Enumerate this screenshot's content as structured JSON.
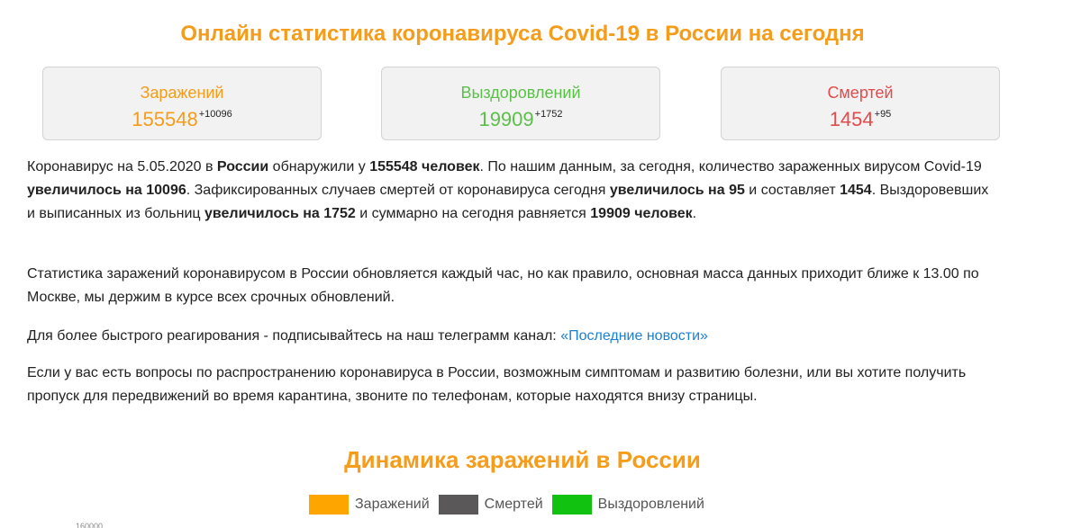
{
  "header": {
    "title": "Онлайн статистика коронавируса Covid-19 в России на сегодня"
  },
  "stats": {
    "infected": {
      "label": "Заражений",
      "value": "155548",
      "delta": "+10096",
      "color": "#f59c1a"
    },
    "recovered": {
      "label": "Выздоровлений",
      "value": "19909",
      "delta": "+1752",
      "color": "#5cbf4a"
    },
    "deaths": {
      "label": "Смертей",
      "value": "1454",
      "delta": "+95",
      "color": "#e24b4b"
    }
  },
  "paragraph1": {
    "t1": "Коронавирус на 5.05.2020 в ",
    "b1": "России",
    "t2": " обнаружили у ",
    "b2": "155548 человек",
    "t3": ". По нашим данным, за сегодня, количество зараженных вирусом Covid-19 ",
    "b3": "увеличилось на 10096",
    "t4": ". Зафиксированных случаев смертей от коронавируса сегодня ",
    "b4": "увеличилось на 95",
    "t5": " и составляет ",
    "b5": "1454",
    "t6": ". Выздоровевших и выписанных из больниц ",
    "b6": "увеличилось на 1752",
    "t7": " и суммарно на сегодня равняется ",
    "b7": "19909 человек",
    "t8": "."
  },
  "paragraph2": {
    "text": "Статистика заражений коронавирусом в России обновляется каждый час, но как правило, основная масса данных приходит ближе к 13.00 по Москве, мы держим в курсе всех срочных обновлений."
  },
  "paragraph3": {
    "text": "Для более быстрого реагирования - подписывайтесь на наш телеграмм канал: ",
    "link": "«Последние новости»"
  },
  "paragraph4": {
    "text": "Если у вас есть вопросы по распространению коронавируса в России, возможным симптомам и развитию болезни, или вы хотите получить пропуск для передвижений во время карантина, звоните по телефонам, которые находятся внизу страницы."
  },
  "chart": {
    "title": "Динамика заражений в России",
    "legend": [
      {
        "label": "Заражений",
        "color": "#ffa500"
      },
      {
        "label": "Смертей",
        "color": "#5a5858"
      },
      {
        "label": "Выздоровлений",
        "color": "#11c211"
      }
    ],
    "axis_top_tick": "160000"
  }
}
